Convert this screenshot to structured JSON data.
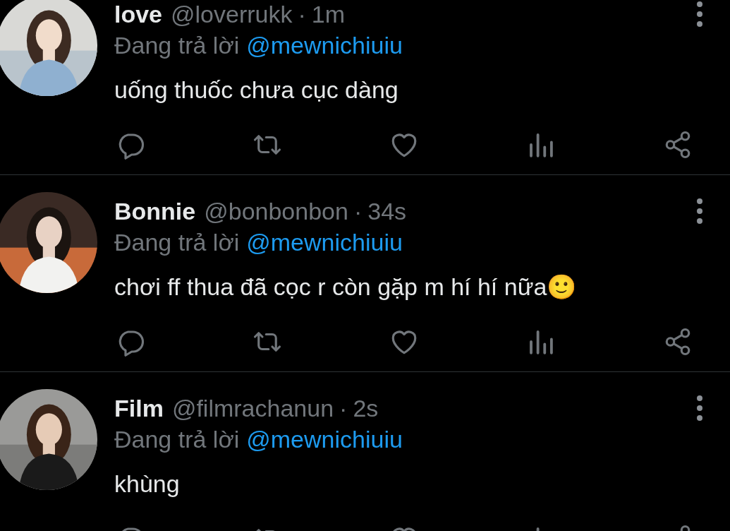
{
  "tweets": [
    {
      "name": "love",
      "handle": "@loverrukk",
      "separator": "·",
      "time": "1m",
      "reply_label": "Đang trả lời",
      "reply_to": "@mewnichiuiu",
      "text": "uống thuốc chưa cục dàng"
    },
    {
      "name": "Bonnie",
      "handle": "@bonbonbon",
      "separator": "·",
      "time": "34s",
      "reply_label": "Đang trả lời",
      "reply_to": "@mewnichiuiu",
      "text": "chơi ff thua đã cọc r còn gặp m hí hí nữa🙂"
    },
    {
      "name": "Film",
      "handle": "@filmrachanun",
      "separator": "·",
      "time": "2s",
      "reply_label": "Đang trả lời",
      "reply_to": "@mewnichiuiu",
      "text": "khùng"
    }
  ]
}
